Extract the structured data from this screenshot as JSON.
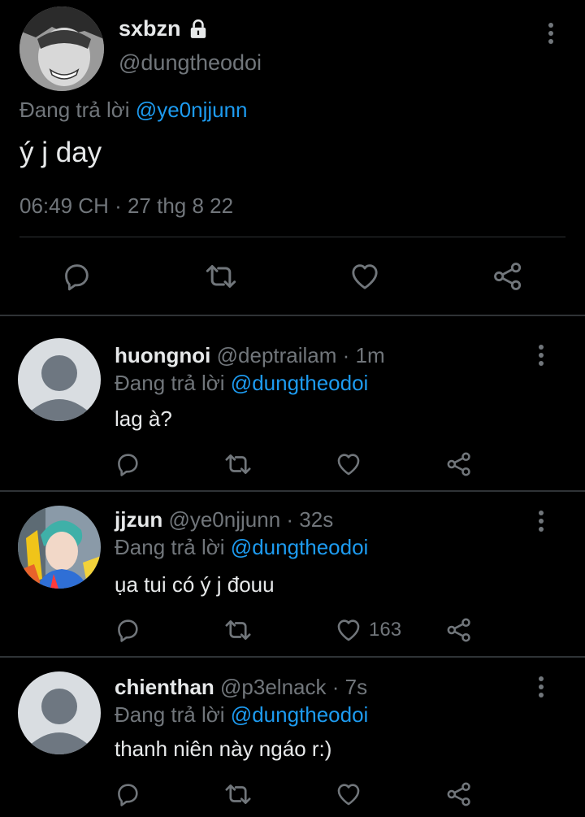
{
  "main_tweet": {
    "display_name": "sxbzn",
    "handle": "@dungtheodoi",
    "replying_prefix": "Đang trả lời",
    "replying_to": "@ye0njjunn",
    "text": "ý j day",
    "timestamp": "06:49 CH · 27 thg 8 22",
    "icons": [
      "reply-icon",
      "retweet-icon",
      "like-icon",
      "share-icon",
      "lock-icon",
      "more-icon"
    ]
  },
  "replies": [
    {
      "display_name": "huongnoi",
      "handle": "@deptrailam",
      "time": "· 1m",
      "replying_prefix": "Đang trả lời",
      "replying_to": "@dungtheodoi",
      "text": "lag à?",
      "like_count": ""
    },
    {
      "display_name": "jjzun",
      "handle": "@ye0njjunn",
      "time": "· 32s",
      "replying_prefix": "Đang trả lời",
      "replying_to": "@dungtheodoi",
      "text": "ụa tui có ý j đouu",
      "like_count": "163"
    },
    {
      "display_name": "chienthan",
      "handle": "@p3elnack",
      "time": "· 7s",
      "replying_prefix": "Đang trả lời",
      "replying_to": "@dungtheodoi",
      "text": "thanh niên này ngáo r:)",
      "like_count": ""
    }
  ],
  "colors": {
    "background": "#000000",
    "text": "#e7e9ea",
    "secondary": "#71767b",
    "link": "#1d9bf0",
    "divider": "#2f3336"
  }
}
